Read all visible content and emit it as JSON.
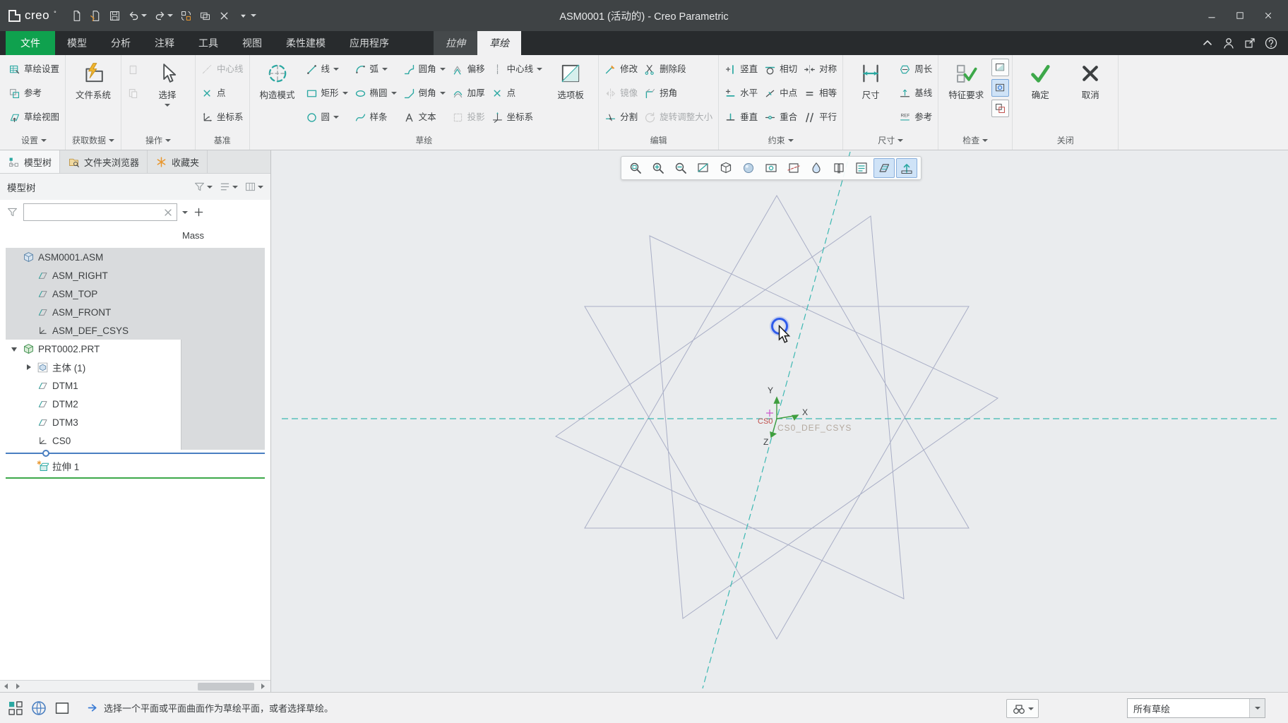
{
  "titlebar": {
    "logo_text": "creo",
    "logo_sup": "°",
    "title": "ASM0001 (活动的) - Creo Parametric",
    "quick_access": [
      {
        "name": "new-file-icon"
      },
      {
        "name": "open-file-icon"
      },
      {
        "name": "save-icon"
      },
      {
        "name": "undo-icon",
        "dropdown": true
      },
      {
        "name": "redo-icon",
        "dropdown": true
      },
      {
        "name": "regenerate-icon"
      },
      {
        "name": "windows-icon"
      },
      {
        "name": "close-model-icon"
      },
      {
        "name": "customize-quick-access-icon",
        "dropdown": true
      }
    ],
    "window_buttons": [
      "minimize-icon",
      "maximize-icon",
      "close-icon"
    ]
  },
  "tab_bar": {
    "tabs": [
      {
        "label": "文件",
        "style": "file"
      },
      {
        "label": "模型"
      },
      {
        "label": "分析"
      },
      {
        "label": "注释"
      },
      {
        "label": "工具"
      },
      {
        "label": "视图"
      },
      {
        "label": "柔性建模"
      },
      {
        "label": "应用程序"
      },
      {
        "label": "拉伸",
        "style": "context"
      },
      {
        "label": "草绘",
        "style": "active"
      }
    ],
    "right_icons": [
      "collapse-ribbon-icon",
      "user-icon",
      "share-icon",
      "help-icon"
    ]
  },
  "ribbon": {
    "groups": [
      {
        "label": "设置",
        "dropdown": true,
        "columns": [
          [
            {
              "label": "草绘设置",
              "icon": "sketch-setup-icon"
            },
            {
              "label": "参考",
              "icon": "references-icon"
            },
            {
              "label": "草绘视图",
              "icon": "sketch-view-icon"
            }
          ]
        ]
      },
      {
        "label": "获取数据",
        "dropdown": true,
        "columns": [
          [
            {
              "label": "文件系统",
              "icon": "file-system-icon",
              "big": true
            }
          ]
        ]
      },
      {
        "label": "操作",
        "dropdown": true,
        "columns": [
          [
            {
              "icon": "paste-icon",
              "disabled": true
            },
            {
              "icon": "clipboard-icon",
              "disabled": true
            }
          ],
          [
            {
              "label": "选择",
              "icon": "select-icon",
              "big": true,
              "dropdown": true
            }
          ]
        ]
      },
      {
        "label": "基准",
        "columns": [
          [
            {
              "label": "中心线",
              "icon": "centerline-icon",
              "disabled": true
            },
            {
              "label": "点",
              "icon": "point-icon"
            },
            {
              "label": "坐标系",
              "icon": "csys-icon"
            }
          ]
        ]
      },
      {
        "label": "草绘",
        "columns": [
          [
            {
              "label": "构造模式",
              "icon": "construction-mode-icon",
              "big": true
            }
          ],
          [
            {
              "label": "线",
              "icon": "line-icon",
              "dropdown": true
            },
            {
              "label": "矩形",
              "icon": "rectangle-icon",
              "dropdown": true
            },
            {
              "label": "圆",
              "icon": "circle-icon",
              "dropdown": true
            }
          ],
          [
            {
              "label": "弧",
              "icon": "arc-icon",
              "dropdown": true
            },
            {
              "label": "椭圆",
              "icon": "ellipse-icon",
              "dropdown": true
            },
            {
              "label": "样条",
              "icon": "spline-icon"
            }
          ],
          [
            {
              "label": "圆角",
              "icon": "fillet-icon",
              "dropdown": true
            },
            {
              "label": "倒角",
              "icon": "chamfer-icon",
              "dropdown": true
            },
            {
              "label": "文本",
              "icon": "text-icon"
            }
          ],
          [
            {
              "label": "偏移",
              "icon": "offset-icon"
            },
            {
              "label": "加厚",
              "icon": "thicken-icon"
            },
            {
              "label": "投影",
              "icon": "project-icon",
              "disabled": true
            }
          ],
          [
            {
              "label": "中心线",
              "icon": "centerline2-icon",
              "dropdown": true
            },
            {
              "label": "点",
              "icon": "point2-icon"
            },
            {
              "label": "坐标系",
              "icon": "csys2-icon"
            }
          ],
          [
            {
              "label": "选项板",
              "icon": "palette-icon",
              "big": true
            }
          ]
        ]
      },
      {
        "label": "编辑",
        "columns": [
          [
            {
              "label": "修改",
              "icon": "modify-icon"
            },
            {
              "label": "镜像",
              "icon": "mirror-icon",
              "disabled": true
            },
            {
              "label": "分割",
              "icon": "divide-icon"
            }
          ],
          [
            {
              "label": "删除段",
              "icon": "delete-segment-icon"
            },
            {
              "label": "拐角",
              "icon": "corner-icon"
            },
            {
              "label": "旋转调整大小",
              "icon": "rotate-resize-icon",
              "disabled": true
            }
          ]
        ]
      },
      {
        "label": "约束",
        "dropdown": true,
        "columns": [
          [
            {
              "label": "竖直",
              "icon": "vertical-icon"
            },
            {
              "label": "水平",
              "icon": "horizontal-icon"
            },
            {
              "label": "垂直",
              "icon": "perpendicular-icon"
            }
          ],
          [
            {
              "label": "相切",
              "icon": "tangent-icon"
            },
            {
              "label": "中点",
              "icon": "midpoint-icon"
            },
            {
              "label": "重合",
              "icon": "coincident-icon"
            }
          ],
          [
            {
              "label": "对称",
              "icon": "symmetric-icon"
            },
            {
              "label": "相等",
              "icon": "equal-icon"
            },
            {
              "label": "平行",
              "icon": "parallel-icon"
            }
          ]
        ]
      },
      {
        "label": "尺寸",
        "dropdown": true,
        "columns": [
          [
            {
              "label": "尺寸",
              "icon": "dimension-icon",
              "big": true
            }
          ],
          [
            {
              "label": "周长",
              "icon": "perimeter-icon"
            },
            {
              "label": "基线",
              "icon": "baseline-icon"
            },
            {
              "label": "参考",
              "icon": "ref-dim-icon"
            }
          ]
        ]
      },
      {
        "label": "检查",
        "dropdown": true,
        "columns": [
          [
            {
              "label": "特征要求",
              "icon": "feature-req-icon",
              "big": true
            }
          ],
          [
            {
              "icon": "inspect-shade-icon",
              "toggle": true
            },
            {
              "icon": "inspect-highlight-icon",
              "toggle": true,
              "active": true
            },
            {
              "icon": "inspect-overlap-icon",
              "toggle": true
            }
          ]
        ]
      },
      {
        "label": "关闭",
        "columns": [
          [
            {
              "label": "确定",
              "icon": "ok-icon",
              "big": true
            }
          ],
          [
            {
              "label": "取消",
              "icon": "cancel-icon",
              "big": true
            }
          ]
        ]
      }
    ]
  },
  "left_panel": {
    "tabs": [
      {
        "label": "模型树",
        "icon": "model-tree-icon",
        "active": true
      },
      {
        "label": "文件夹浏览器",
        "icon": "folder-browser-icon"
      },
      {
        "label": "收藏夹",
        "icon": "favorites-icon"
      }
    ],
    "header": {
      "title": "模型树",
      "icons": [
        "filter-settings-icon",
        "list-settings-icon",
        "columns-display-icon"
      ]
    },
    "search": {
      "value": "",
      "placeholder": ""
    },
    "column_header": "Mass",
    "tree": [
      {
        "label": "ASM0001.ASM",
        "icon": "assembly-icon",
        "indent": 0,
        "shaded": true
      },
      {
        "label": "ASM_RIGHT",
        "icon": "datum-plane-icon",
        "indent": 1,
        "shaded": true
      },
      {
        "label": "ASM_TOP",
        "icon": "datum-plane-icon",
        "indent": 1,
        "shaded": true
      },
      {
        "label": "ASM_FRONT",
        "icon": "datum-plane-icon",
        "indent": 1,
        "shaded": true
      },
      {
        "label": "ASM_DEF_CSYS",
        "icon": "csys-tree-icon",
        "indent": 1,
        "shaded": true
      },
      {
        "label": "PRT0002.PRT",
        "icon": "part-icon",
        "indent": 0,
        "expand": "open"
      },
      {
        "label": "主体 (1)",
        "icon": "body-icon",
        "indent": 1,
        "expand": "closed"
      },
      {
        "label": "DTM1",
        "icon": "datum-plane-icon",
        "indent": 1
      },
      {
        "label": "DTM2",
        "icon": "datum-plane-icon",
        "indent": 1
      },
      {
        "label": "DTM3",
        "icon": "datum-plane-icon",
        "indent": 1
      },
      {
        "label": "CS0",
        "icon": "csys-tree-icon",
        "indent": 1
      },
      {
        "type": "locator"
      },
      {
        "label": "拉伸 1",
        "icon": "extrude-icon",
        "indent": 1
      },
      {
        "type": "active-line"
      }
    ]
  },
  "graphics": {
    "toolbar": [
      {
        "name": "zoom-region-icon"
      },
      {
        "name": "zoom-in-icon"
      },
      {
        "name": "zoom-out-icon"
      },
      {
        "name": "redraw-icon"
      },
      {
        "name": "display-style-icon"
      },
      {
        "name": "shading-icon"
      },
      {
        "name": "capture-icon"
      },
      {
        "name": "section-icon"
      },
      {
        "name": "appearance-icon"
      },
      {
        "name": "saved-views-icon"
      },
      {
        "name": "view-manager-icon"
      },
      {
        "name": "sketch-display-icon",
        "active": true
      },
      {
        "name": "sketch-orientation-icon",
        "active": true
      }
    ],
    "labels": {
      "axis_x": "X",
      "axis_y": "Y",
      "axis_z": "Z",
      "csys_primary": "CS0",
      "csys_full": "CS0_DEF_CSYS"
    }
  },
  "statusbar": {
    "left_icons": [
      "navigator-toggle-icon",
      "web-browser-icon",
      "panel-toggle-icon"
    ],
    "message": "选择一个平面或平面曲面作为草绘平面，或者选择草绘。",
    "search_icon": "binoculars-icon",
    "filter_label": "所有草绘"
  }
}
